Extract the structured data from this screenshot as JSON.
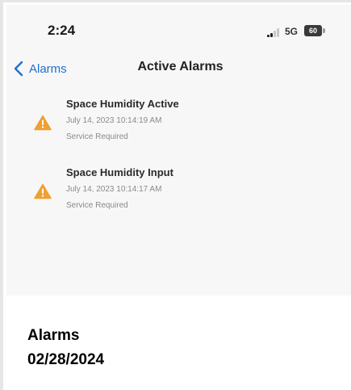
{
  "status_bar": {
    "time": "2:24",
    "network": "5G",
    "battery": "60"
  },
  "nav": {
    "back_label": "Alarms",
    "title": "Active Alarms"
  },
  "alarms": [
    {
      "title": "Space Humidity Active",
      "timestamp": "July 14, 2023 10:14:19 AM",
      "status": "Service Required",
      "icon": "warning-icon",
      "icon_color": "#f0a030"
    },
    {
      "title": "Space Humidity Input",
      "timestamp": "July 14, 2023 10:14:17 AM",
      "status": "Service Required",
      "icon": "warning-icon",
      "icon_color": "#f0a030"
    }
  ],
  "caption": {
    "line1": "Alarms",
    "line2": "02/28/2024"
  },
  "colors": {
    "link": "#1f6fd1",
    "warning": "#f0a030"
  }
}
